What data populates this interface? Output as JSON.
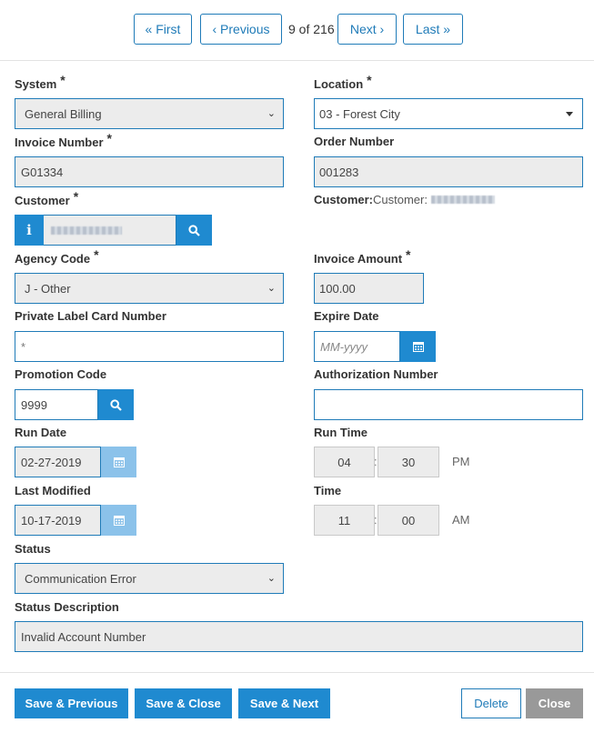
{
  "pager": {
    "first": "« First",
    "previous": "‹ Previous",
    "position": "9 of 216",
    "next": "Next ›",
    "last": "Last »"
  },
  "form": {
    "system": {
      "label": "System",
      "value": "General Billing"
    },
    "location": {
      "label": "Location",
      "value": "03 - Forest City"
    },
    "invoice_number": {
      "label": "Invoice Number",
      "value": "G01334"
    },
    "order_number": {
      "label": "Order Number",
      "value": "001283"
    },
    "customer": {
      "label": "Customer",
      "info_icon": "info-icon"
    },
    "customer_info": {
      "label": "Customer:",
      "text": "Customer:"
    },
    "agency_code": {
      "label": "Agency Code",
      "value": "J - Other"
    },
    "invoice_amount": {
      "label": "Invoice Amount",
      "value": "100.00"
    },
    "private_label": {
      "label": "Private Label Card Number",
      "value": "*"
    },
    "expire_date": {
      "label": "Expire Date",
      "placeholder": "MM-yyyy"
    },
    "promotion_code": {
      "label": "Promotion Code",
      "value": "9999"
    },
    "authorization_number": {
      "label": "Authorization Number",
      "value": ""
    },
    "run_date": {
      "label": "Run Date",
      "value": "02-27-2019"
    },
    "run_time": {
      "label": "Run Time",
      "hour": "04",
      "minute": "30",
      "ampm": "PM"
    },
    "last_modified": {
      "label": "Last Modified",
      "value": "10-17-2019"
    },
    "time": {
      "label": "Time",
      "hour": "11",
      "minute": "00",
      "ampm": "AM"
    },
    "status": {
      "label": "Status",
      "value": "Communication Error"
    },
    "status_description": {
      "label": "Status Description",
      "value": "Invalid Account Number"
    },
    "required_mark": "*",
    "colon": ":"
  },
  "actions": {
    "save_previous": "Save & Previous",
    "save_close": "Save & Close",
    "save_next": "Save & Next",
    "delete": "Delete",
    "close": "Close"
  },
  "colors": {
    "primary": "#1f8ad0",
    "border": "#1f7bb8",
    "disabled": "#8bc2ea",
    "close_gray": "#999999"
  }
}
